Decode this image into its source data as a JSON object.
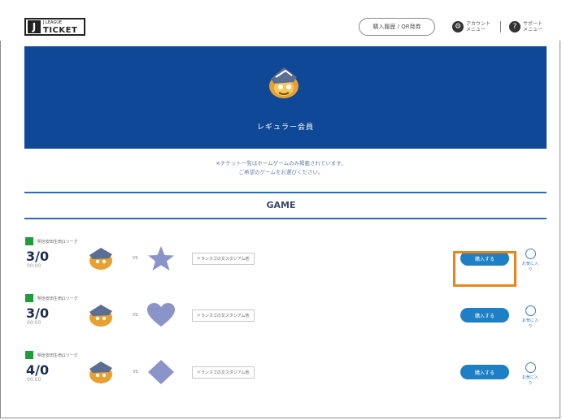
{
  "header": {
    "logo_mark": "J",
    "logo_text": "TICKET",
    "logo_subtext": "J.LEAGUE",
    "history_button": "購入履歴 / QR発券",
    "account_label_1": "アカウント",
    "account_label_2": "メニュー",
    "support_label_1": "サポート",
    "support_label_2": "メニュー"
  },
  "hero": {
    "member_label": "レギュラー会員",
    "background_color": "#0f4896"
  },
  "notice": {
    "line1": "※チケット一覧はホームゲームのみ掲載されています。",
    "line2": "ご希望のゲームをお選びください。"
  },
  "game_section": {
    "heading": "GAME"
  },
  "matches": [
    {
      "category": "明治安田生命J1リーグ",
      "date": "3/0",
      "time": "00:00",
      "vs": "VS",
      "opponent_icon": "star-icon",
      "venue": "ドランスゴの文スタジアム他",
      "buy_label": "購入する",
      "fav_label": "お気に入り"
    },
    {
      "category": "明治安田生命J1リーグ",
      "date": "3/0",
      "time": "00:00",
      "vs": "VS",
      "opponent_icon": "heart-icon",
      "venue": "ドランスゴの文スタジアム他",
      "buy_label": "購入する",
      "fav_label": "お気に入り"
    },
    {
      "category": "明治安田生命J1リーグ",
      "date": "4/0",
      "time": "00:00",
      "vs": "VS",
      "opponent_icon": "diamond-icon",
      "venue": "ドランスゴの文スタジアム他",
      "buy_label": "購入する",
      "fav_label": "お気に入り"
    }
  ],
  "colors": {
    "accent": "#1f7fc4",
    "category": "#1f9b3c",
    "highlight": "#e8861c",
    "team_icon": "#8b94c8"
  }
}
